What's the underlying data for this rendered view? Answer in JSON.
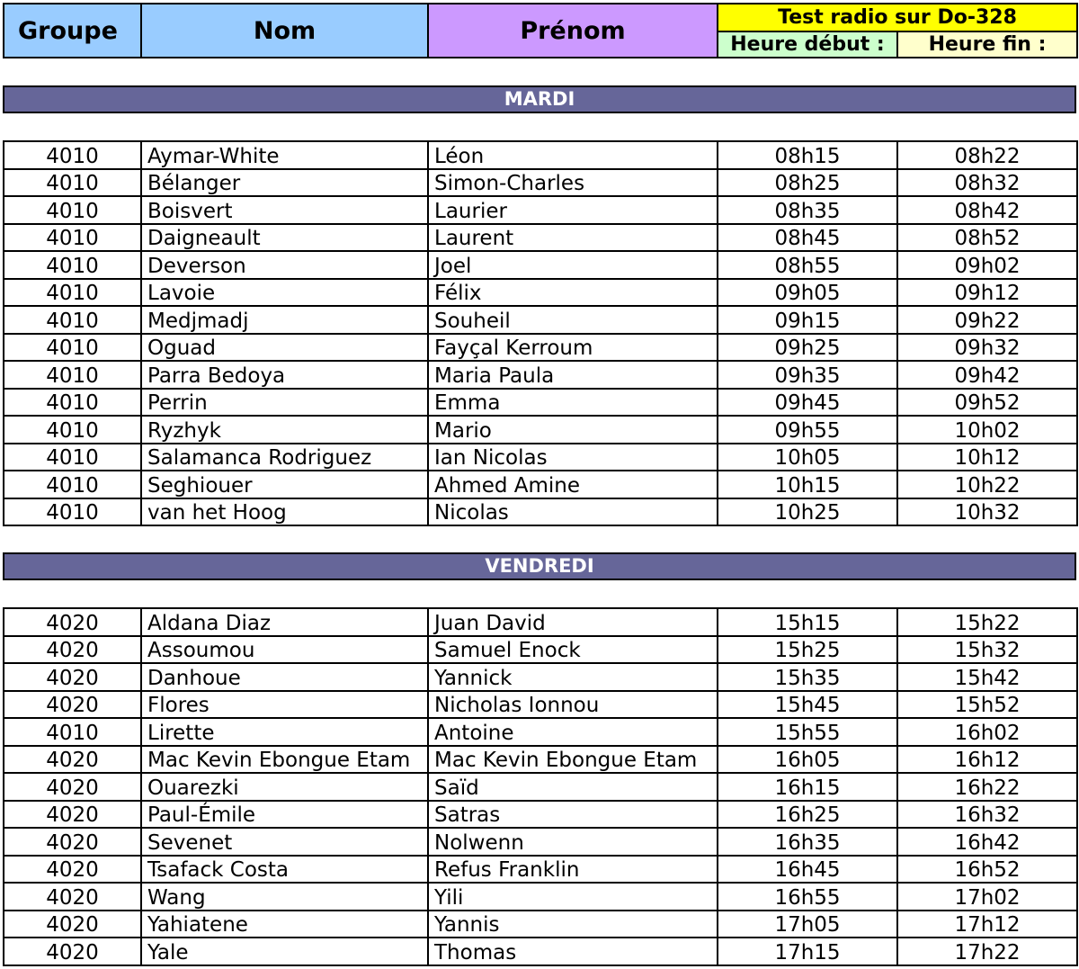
{
  "header": {
    "groupe": "Groupe",
    "nom": "Nom",
    "prenom": "Prénom",
    "test": "Test radio sur Do-328",
    "heure_debut": "Heure début :",
    "heure_fin": "Heure fin :"
  },
  "days": [
    {
      "label": "MARDI",
      "rows": [
        {
          "groupe": "4010",
          "nom": "Aymar-White",
          "prenom": "Léon",
          "debut": "08h15",
          "fin": "08h22"
        },
        {
          "groupe": "4010",
          "nom": "Bélanger",
          "prenom": "Simon-Charles",
          "debut": "08h25",
          "fin": "08h32"
        },
        {
          "groupe": "4010",
          "nom": "Boisvert",
          "prenom": "Laurier",
          "debut": "08h35",
          "fin": "08h42"
        },
        {
          "groupe": "4010",
          "nom": "Daigneault",
          "prenom": "Laurent",
          "debut": "08h45",
          "fin": "08h52"
        },
        {
          "groupe": "4010",
          "nom": "Deverson",
          "prenom": "Joel",
          "debut": "08h55",
          "fin": "09h02"
        },
        {
          "groupe": "4010",
          "nom": "Lavoie",
          "prenom": "Félix",
          "debut": "09h05",
          "fin": "09h12"
        },
        {
          "groupe": "4010",
          "nom": "Medjmadj",
          "prenom": "Souheil",
          "debut": "09h15",
          "fin": "09h22"
        },
        {
          "groupe": "4010",
          "nom": "Oguad",
          "prenom": "Fayçal Kerroum",
          "debut": "09h25",
          "fin": "09h32"
        },
        {
          "groupe": "4010",
          "nom": "Parra Bedoya",
          "prenom": "Maria Paula",
          "debut": "09h35",
          "fin": "09h42"
        },
        {
          "groupe": "4010",
          "nom": "Perrin",
          "prenom": "Emma",
          "debut": "09h45",
          "fin": "09h52"
        },
        {
          "groupe": "4010",
          "nom": "Ryzhyk",
          "prenom": "Mario",
          "debut": "09h55",
          "fin": "10h02"
        },
        {
          "groupe": "4010",
          "nom": "Salamanca Rodriguez",
          "prenom": "Ian Nicolas",
          "debut": "10h05",
          "fin": "10h12"
        },
        {
          "groupe": "4010",
          "nom": "Seghiouer",
          "prenom": "Ahmed Amine",
          "debut": "10h15",
          "fin": "10h22"
        },
        {
          "groupe": "4010",
          "nom": "van het Hoog",
          "prenom": "Nicolas",
          "debut": "10h25",
          "fin": "10h32"
        }
      ]
    },
    {
      "label": "VENDREDI",
      "rows": [
        {
          "groupe": "4020",
          "nom": "Aldana Diaz",
          "prenom": "Juan David",
          "debut": "15h15",
          "fin": "15h22"
        },
        {
          "groupe": "4020",
          "nom": "Assoumou",
          "prenom": "Samuel Enock",
          "debut": "15h25",
          "fin": "15h32"
        },
        {
          "groupe": "4020",
          "nom": "Danhoue",
          "prenom": "Yannick",
          "debut": "15h35",
          "fin": "15h42"
        },
        {
          "groupe": "4020",
          "nom": "Flores",
          "prenom": "Nicholas Ionnou",
          "debut": "15h45",
          "fin": "15h52"
        },
        {
          "groupe": "4010",
          "nom": "Lirette",
          "prenom": "Antoine",
          "debut": "15h55",
          "fin": "16h02"
        },
        {
          "groupe": "4020",
          "nom": "Mac Kevin Ebongue Etam",
          "prenom": "Mac Kevin Ebongue Etam",
          "debut": "16h05",
          "fin": "16h12"
        },
        {
          "groupe": "4020",
          "nom": "Ouarezki",
          "prenom": "Saïd",
          "debut": "16h15",
          "fin": "16h22"
        },
        {
          "groupe": "4020",
          "nom": "Paul-Émile",
          "prenom": "Satras",
          "debut": "16h25",
          "fin": "16h32"
        },
        {
          "groupe": "4020",
          "nom": "Sevenet",
          "prenom": "Nolwenn",
          "debut": "16h35",
          "fin": "16h42"
        },
        {
          "groupe": "4020",
          "nom": "Tsafack Costa",
          "prenom": "Refus Franklin",
          "debut": "16h45",
          "fin": "16h52"
        },
        {
          "groupe": "4020",
          "nom": "Wang",
          "prenom": "Yili",
          "debut": "16h55",
          "fin": "17h02"
        },
        {
          "groupe": "4020",
          "nom": "Yahiatene",
          "prenom": "Yannis",
          "debut": "17h05",
          "fin": "17h12"
        },
        {
          "groupe": "4020",
          "nom": "Yale",
          "prenom": "Thomas",
          "debut": "17h15",
          "fin": "17h22"
        }
      ]
    }
  ]
}
